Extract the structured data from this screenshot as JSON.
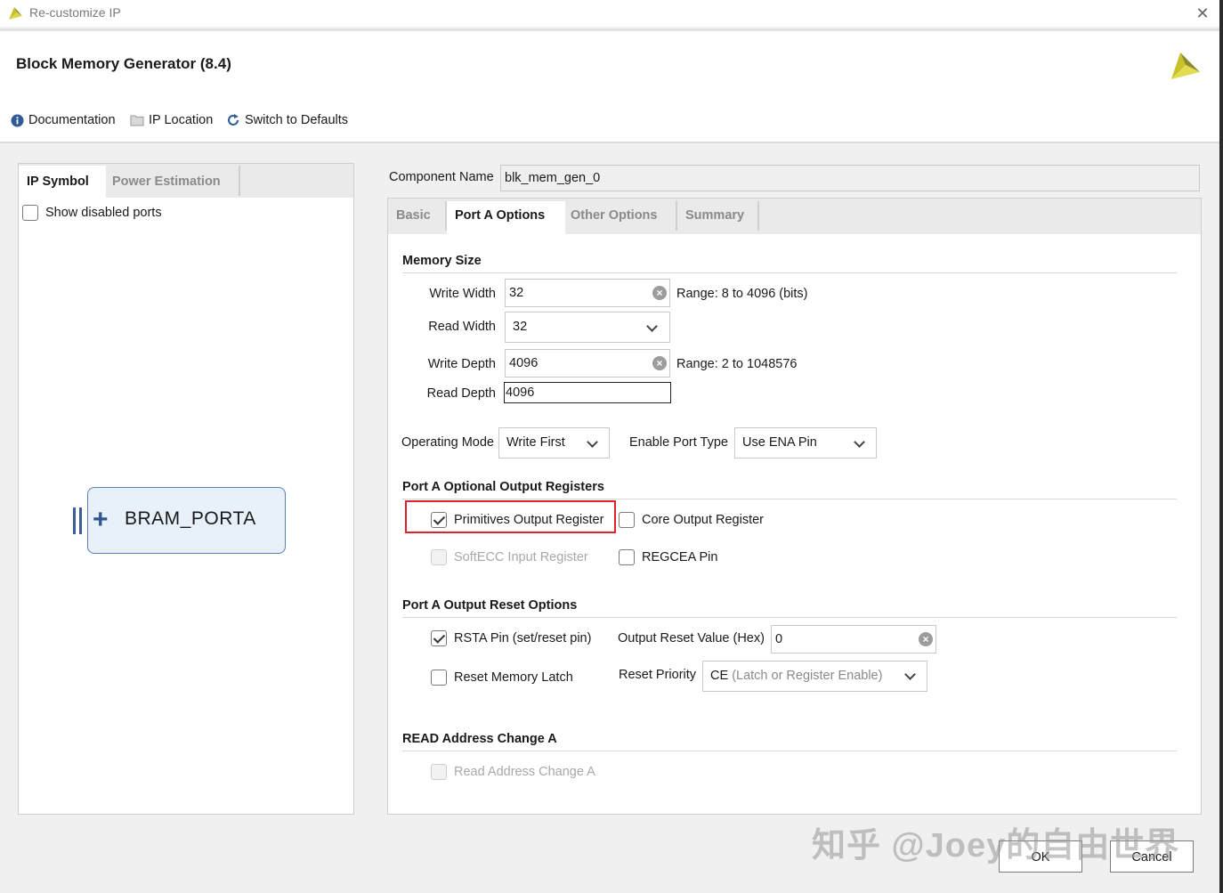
{
  "window": {
    "title": "Re-customize IP",
    "close_symbol": "✕"
  },
  "header": {
    "title": "Block Memory Generator (8.4)",
    "toolbar": {
      "documentation": "Documentation",
      "ip_location": "IP Location",
      "switch_defaults": "Switch to Defaults"
    }
  },
  "left_panel": {
    "tabs": [
      "IP Symbol",
      "Power Estimation"
    ],
    "show_disabled_ports": "Show disabled ports",
    "bram_port": "BRAM_PORTA"
  },
  "component": {
    "label": "Component Name",
    "value": "blk_mem_gen_0"
  },
  "tabs": [
    "Basic",
    "Port A Options",
    "Other Options",
    "Summary"
  ],
  "memory_size": {
    "title": "Memory Size",
    "write_width_label": "Write Width",
    "write_width": "32",
    "write_width_range": "Range: 8 to 4096 (bits)",
    "read_width_label": "Read Width",
    "read_width": "32",
    "write_depth_label": "Write Depth",
    "write_depth": "4096",
    "write_depth_range": "Range: 2 to 1048576",
    "read_depth_label": "Read Depth",
    "read_depth": "4096"
  },
  "mode": {
    "operating_mode_label": "Operating Mode",
    "operating_mode": "Write First",
    "enable_port_label": "Enable Port Type",
    "enable_port": "Use ENA Pin"
  },
  "output_registers": {
    "title": "Port A Optional Output Registers",
    "primitives": "Primitives Output Register",
    "core": "Core Output Register",
    "softecc": "SoftECC Input Register",
    "regcea": "REGCEA Pin"
  },
  "reset_options": {
    "title": "Port A Output Reset Options",
    "rsta": "RSTA Pin (set/reset pin)",
    "reset_value_label": "Output Reset Value (Hex)",
    "reset_value": "0",
    "reset_latch": "Reset Memory Latch",
    "priority_label": "Reset Priority",
    "priority_value": "CE",
    "priority_desc": "(Latch or Register Enable)"
  },
  "read_address": {
    "title": "READ Address Change A",
    "checkbox": "Read Address Change A"
  },
  "buttons": {
    "ok": "OK",
    "cancel": "Cancel"
  },
  "watermark": "知乎 @Joey的自由世界",
  "colors": {
    "highlight": "#e0202a",
    "brand": "#c8c22a",
    "port_fill": "#e8f0fa"
  }
}
